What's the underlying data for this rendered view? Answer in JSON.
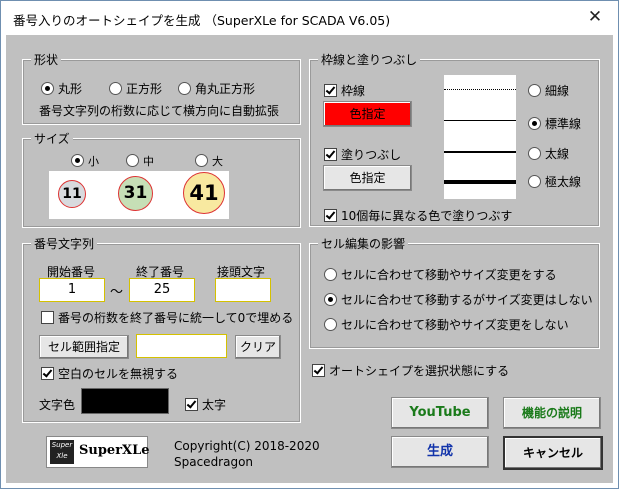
{
  "window": {
    "title": "番号入りのオートシェイプを生成 （SuperXLe for SCADA V6.05)",
    "close_glyph": "✕"
  },
  "shape": {
    "label": "形状",
    "options": [
      "丸形",
      "正方形",
      "角丸正方形"
    ],
    "selected": 0,
    "note": "番号文字列の桁数に応じて横方向に自動拡張"
  },
  "size": {
    "label": "サイズ",
    "options": [
      "小",
      "中",
      "大"
    ],
    "selected": 0,
    "samples": [
      "11",
      "31",
      "41"
    ],
    "sample_colors": [
      "#d8dade",
      "#c6dfb6",
      "#f8e9a0"
    ]
  },
  "number": {
    "label": "番号文字列",
    "start_label": "開始番号",
    "end_label": "終了番号",
    "prefix_label": "接頭文字",
    "start_value": "1",
    "end_value": "25",
    "prefix_value": "",
    "tilde": "～",
    "zero_pad_label": "番号の桁数を終了番号に統一して0で埋める",
    "zero_pad_checked": false,
    "range_button": "セル範囲指定",
    "range_value": "",
    "clear_button": "クリア",
    "ignore_blank_label": "空白のセルを無視する",
    "ignore_blank_checked": true,
    "text_color_label": "文字色",
    "text_color": "#000000",
    "bold_label": "太字",
    "bold_checked": true
  },
  "line_fill": {
    "label": "枠線と塗りつぶし",
    "border_label": "枠線",
    "border_checked": true,
    "border_color_button": "色指定",
    "border_color": "#ff0000",
    "fill_label": "塗りつぶし",
    "fill_checked": true,
    "fill_color_button": "色指定",
    "line_options": [
      "細線",
      "標準線",
      "太線",
      "極太線"
    ],
    "line_selected": 1,
    "every10_label": "10個毎に異なる色で塗りつぶす",
    "every10_checked": true
  },
  "cell_edit": {
    "label": "セル編集の影響",
    "options": [
      "セルに合わせて移動やサイズ変更をする",
      "セルに合わせて移動するがサイズ変更はしない",
      "セルに合わせて移動やサイズ変更をしない"
    ],
    "selected": 1
  },
  "select_after": {
    "label": "オートシェイプを選択状態にする",
    "checked": true
  },
  "buttons": {
    "youtube": "YouTube",
    "help": "機能の説明",
    "generate": "生成",
    "cancel": "キャンセル"
  },
  "logo": {
    "name": "SuperXLe",
    "badge_top": "Super",
    "badge_bottom": "Xle"
  },
  "copyright": {
    "line1": "Copyright(C) 2018-2020",
    "line2": "Spacedragon"
  },
  "colors": {
    "panel": "#c0c0c0",
    "youtube_text": "#1a7a1a",
    "generate_text": "#1133aa"
  }
}
